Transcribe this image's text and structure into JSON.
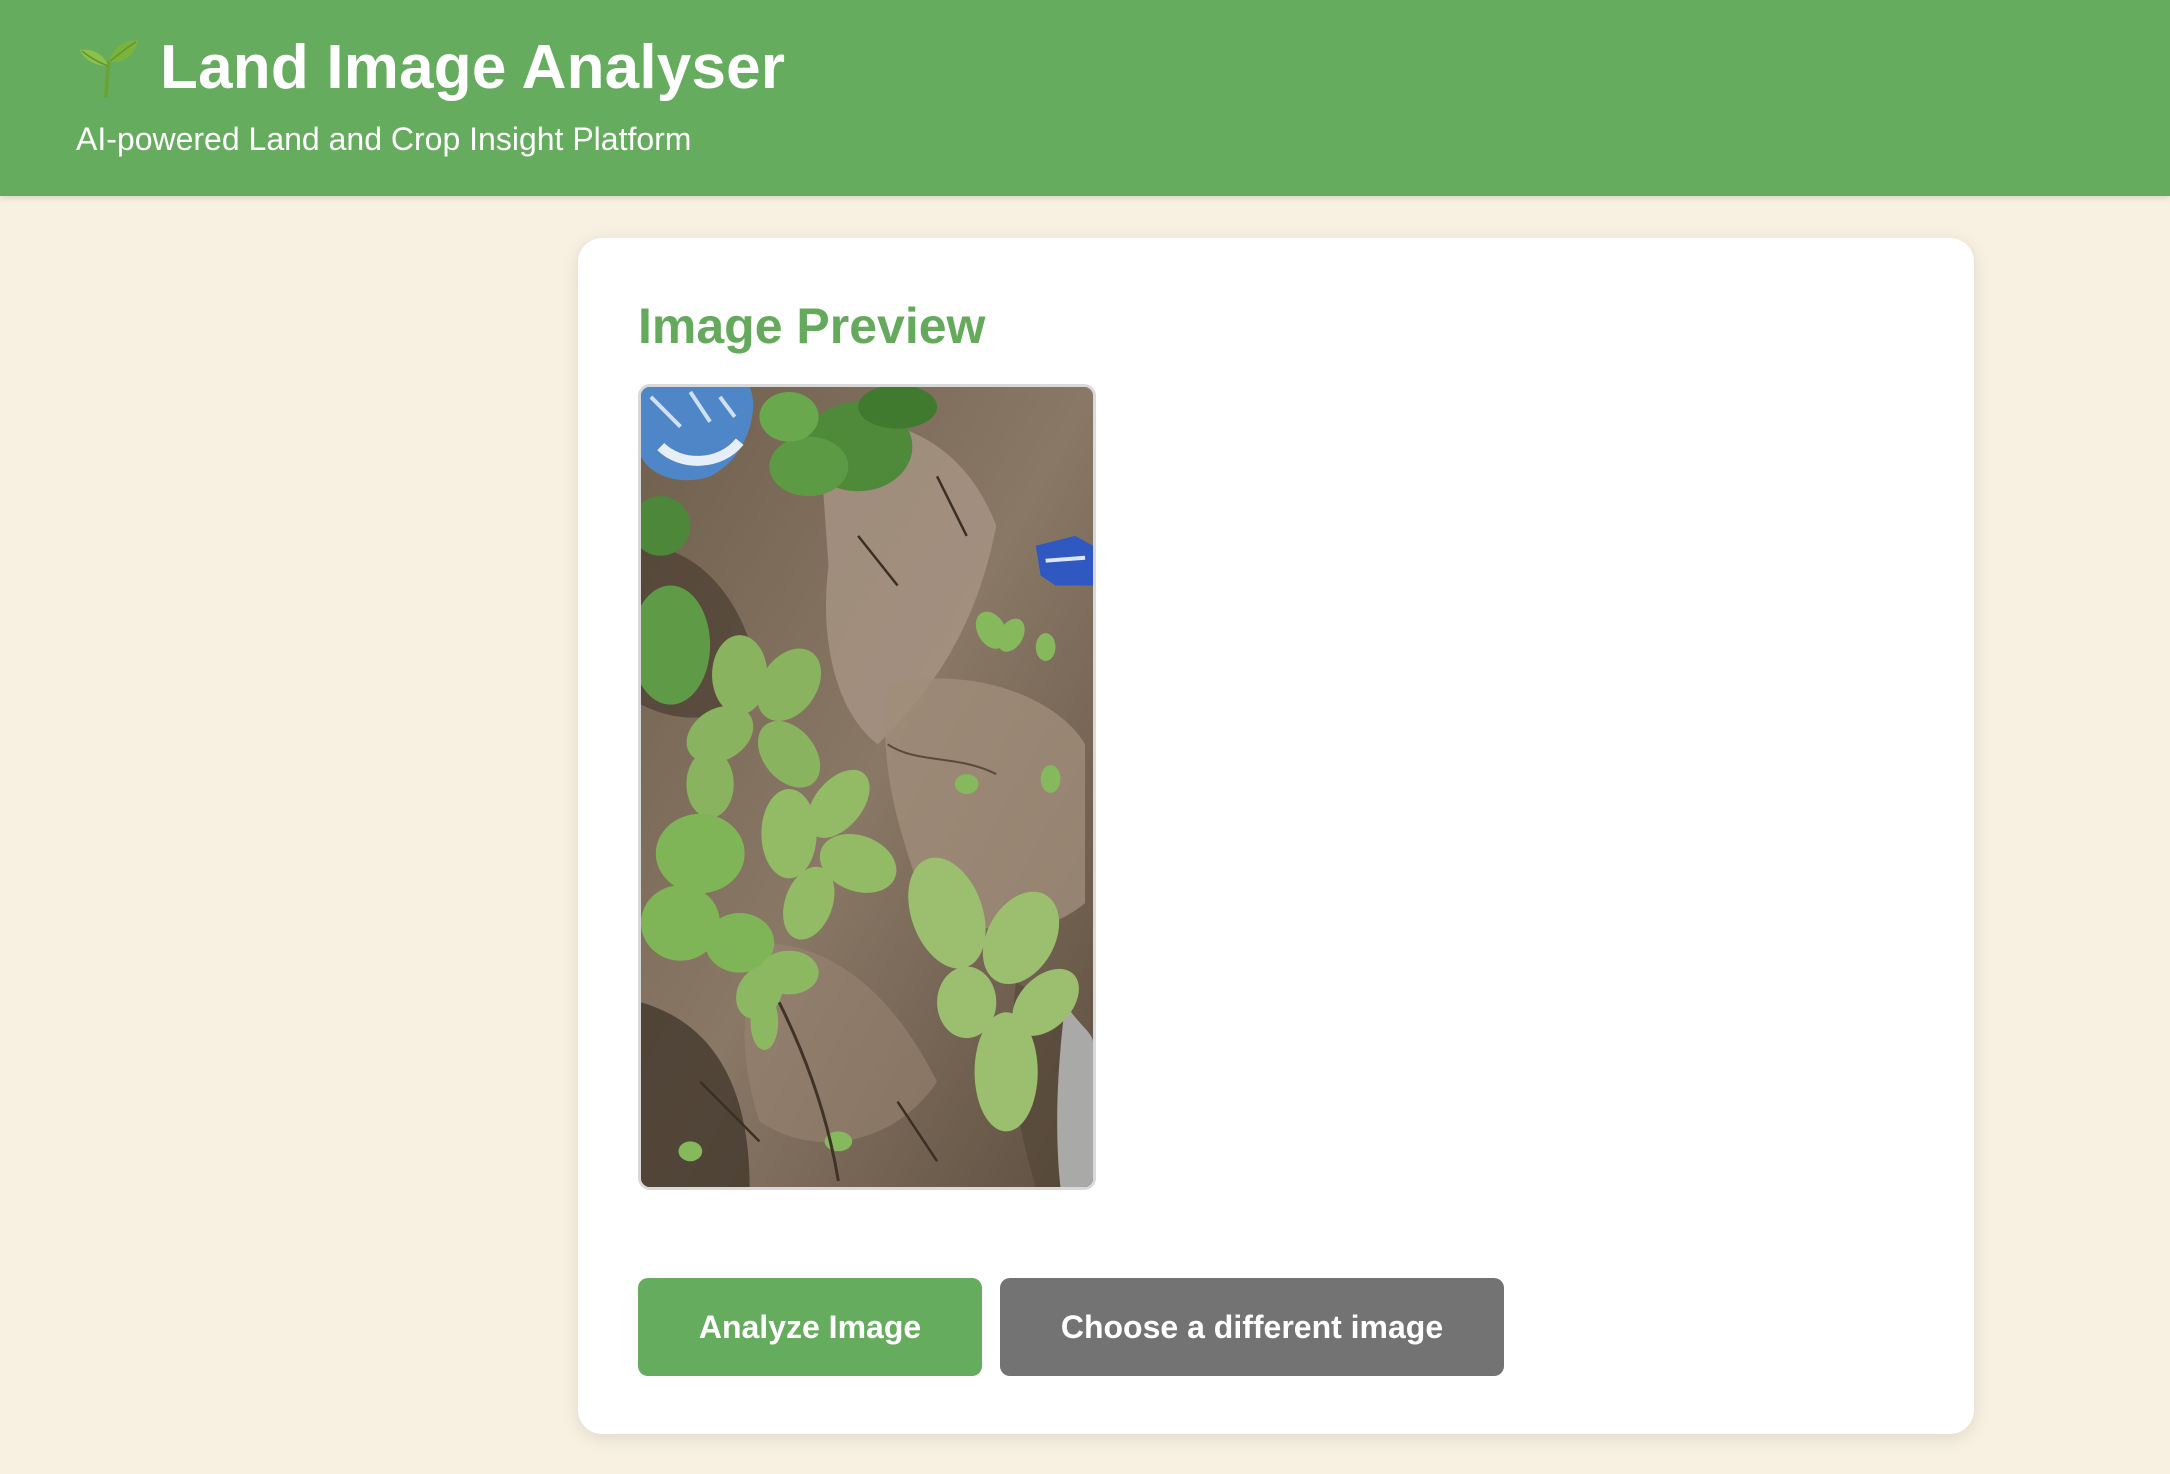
{
  "header": {
    "title": "Land Image Analyser",
    "subtitle": "AI-powered Land and Crop Insight Platform",
    "icon": "seedling-icon"
  },
  "preview": {
    "heading": "Image Preview",
    "image_alt": "Uploaded land photo showing soil with weeds and small plants"
  },
  "actions": {
    "analyze_label": "Analyze Image",
    "choose_label": "Choose a different image"
  },
  "colors": {
    "brand_green": "#66ac5e",
    "page_background": "#f8f1e1",
    "secondary_button": "#737373"
  }
}
